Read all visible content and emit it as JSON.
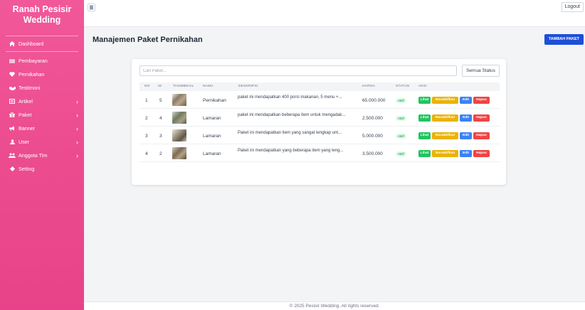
{
  "brand": {
    "line1": "Ranah Pesisir",
    "line2": "Wedding"
  },
  "sidebar": {
    "items": [
      {
        "label": "Dashboard",
        "icon": "home-icon"
      },
      {
        "label": "Pembayaran",
        "icon": "money-icon"
      },
      {
        "label": "Pernikahan",
        "icon": "heart-icon"
      },
      {
        "label": "Testimoni",
        "icon": "handshake-icon"
      },
      {
        "label": "Artikel",
        "icon": "newspaper-icon"
      },
      {
        "label": "Paket",
        "icon": "gift-icon"
      },
      {
        "label": "Banner",
        "icon": "bullhorn-icon"
      },
      {
        "label": "User",
        "icon": "user-icon"
      },
      {
        "label": "Anggota Tim",
        "icon": "users-icon"
      },
      {
        "label": "Setting",
        "icon": "gear-icon"
      }
    ]
  },
  "topbar": {
    "logout_label": "Logout"
  },
  "page": {
    "title": "Manajemen Paket Pernikahan",
    "add_label": "TAMBAH PAKET"
  },
  "filters": {
    "search_placeholder": "Cari Paket...",
    "status_label": "Semua Status"
  },
  "table": {
    "headers": [
      "NO",
      "ID",
      "THUMBNAIL",
      "NAMA",
      "DESKRIPSI",
      "HARGA",
      "STATUS",
      "AKSI"
    ],
    "rows": [
      {
        "no": "1",
        "id": "5",
        "nama": "Pernikahan",
        "deskripsi": "paket ini mendapatkan 400 porsi makanan, 5 menu +...",
        "harga": "65.000.000",
        "status": "Aktif"
      },
      {
        "no": "2",
        "id": "4",
        "nama": "Lamaran",
        "deskripsi": "paket ini mendapatkan beberapa item untuk mengadak...",
        "harga": "2.500.000",
        "status": "Aktif"
      },
      {
        "no": "3",
        "id": "3",
        "nama": "Lamaran",
        "deskripsi": "Paket ini mendapatkan item yang sangat lengkap unt...",
        "harga": "5.000.000",
        "status": "Aktif"
      },
      {
        "no": "4",
        "id": "2",
        "nama": "Lamaran",
        "deskripsi": "Paket ini mendapatkan yang beberapa item yang leng...",
        "harga": "3.500.000",
        "status": "Aktif"
      }
    ],
    "actions": {
      "view": "Lihat",
      "deactivate": "Nonaktifkan",
      "edit": "Edit",
      "delete": "Hapus"
    }
  },
  "footer": {
    "text": "© 2025 Pesisir Wedding. All rights reserved."
  }
}
